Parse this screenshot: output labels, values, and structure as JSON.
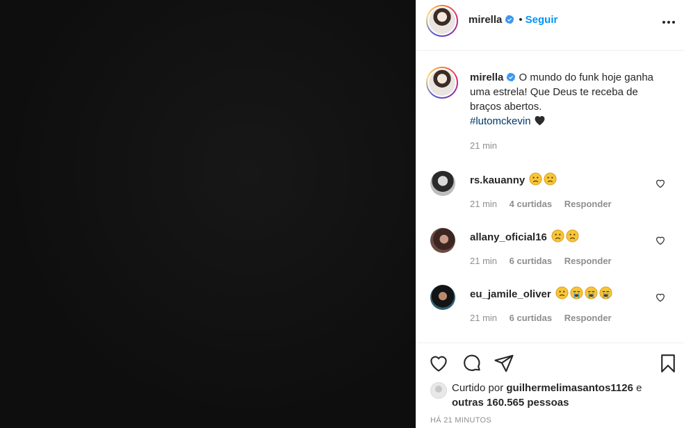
{
  "post": {
    "author": "mirella",
    "follow_label": "Seguir",
    "separator": "•"
  },
  "caption": {
    "username": "mirella",
    "text_before": "O mundo do funk hoje ganha uma estrela! Que Deus te receba de braços abertos.",
    "hashtag": "#lutomckevin",
    "time": "21 min"
  },
  "comments": [
    {
      "username": "rs.kauanny",
      "emojis": [
        "sad",
        "sad"
      ],
      "time": "21 min",
      "likes": "4 curtidas",
      "reply": "Responder"
    },
    {
      "username": "allany_oficial16",
      "emojis": [
        "sad",
        "sad"
      ],
      "time": "21 min",
      "likes": "6 curtidas",
      "reply": "Responder"
    },
    {
      "username": "eu_jamile_oliver",
      "emojis": [
        "sad",
        "cry",
        "cry",
        "cry"
      ],
      "time": "21 min",
      "likes": "6 curtidas",
      "reply": "Responder"
    }
  ],
  "likes": {
    "prefix": "Curtido por",
    "user": "guilhermelimasantos1126",
    "mid": "e",
    "others": "outras 160.565 pessoas"
  },
  "posted_ago": "HÁ 21 MINUTOS",
  "colors": {
    "accent": "#0095f6",
    "verified": "#3897f0",
    "hashtag": "#00376b",
    "muted": "#8e8e8e"
  }
}
